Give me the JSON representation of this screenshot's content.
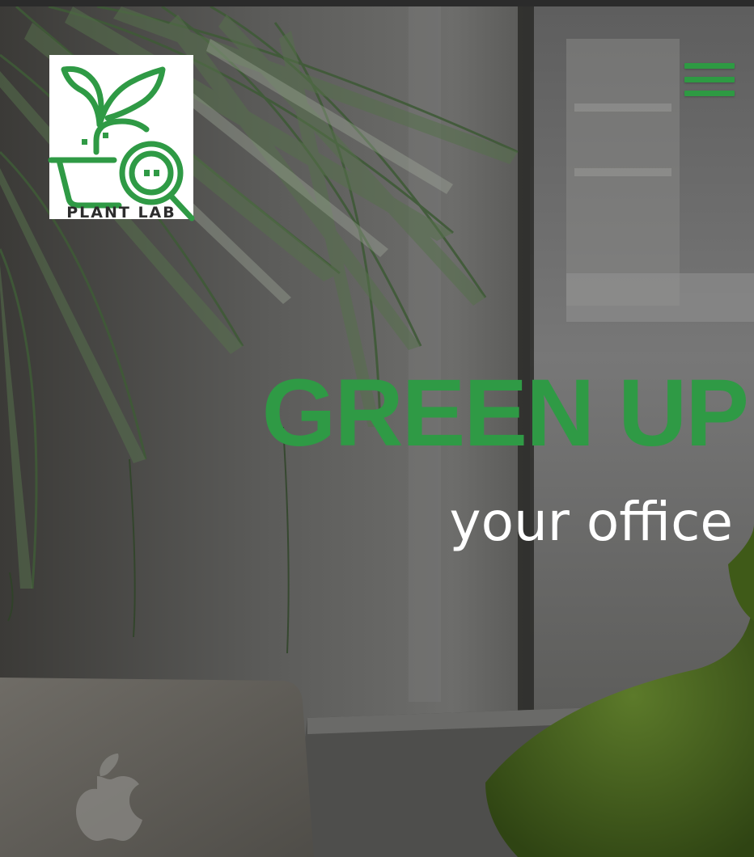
{
  "header": {
    "logo_text": "PLANT LAB",
    "menu_icon": "hamburger-menu-icon",
    "menu_color": "#2e9a43"
  },
  "hero": {
    "headline": "GREEN UP",
    "subheadline": "your office",
    "headline_color": "#2f9a45",
    "subheadline_color": "#ffffff"
  },
  "brand": {
    "accent": "#2e9a43"
  }
}
